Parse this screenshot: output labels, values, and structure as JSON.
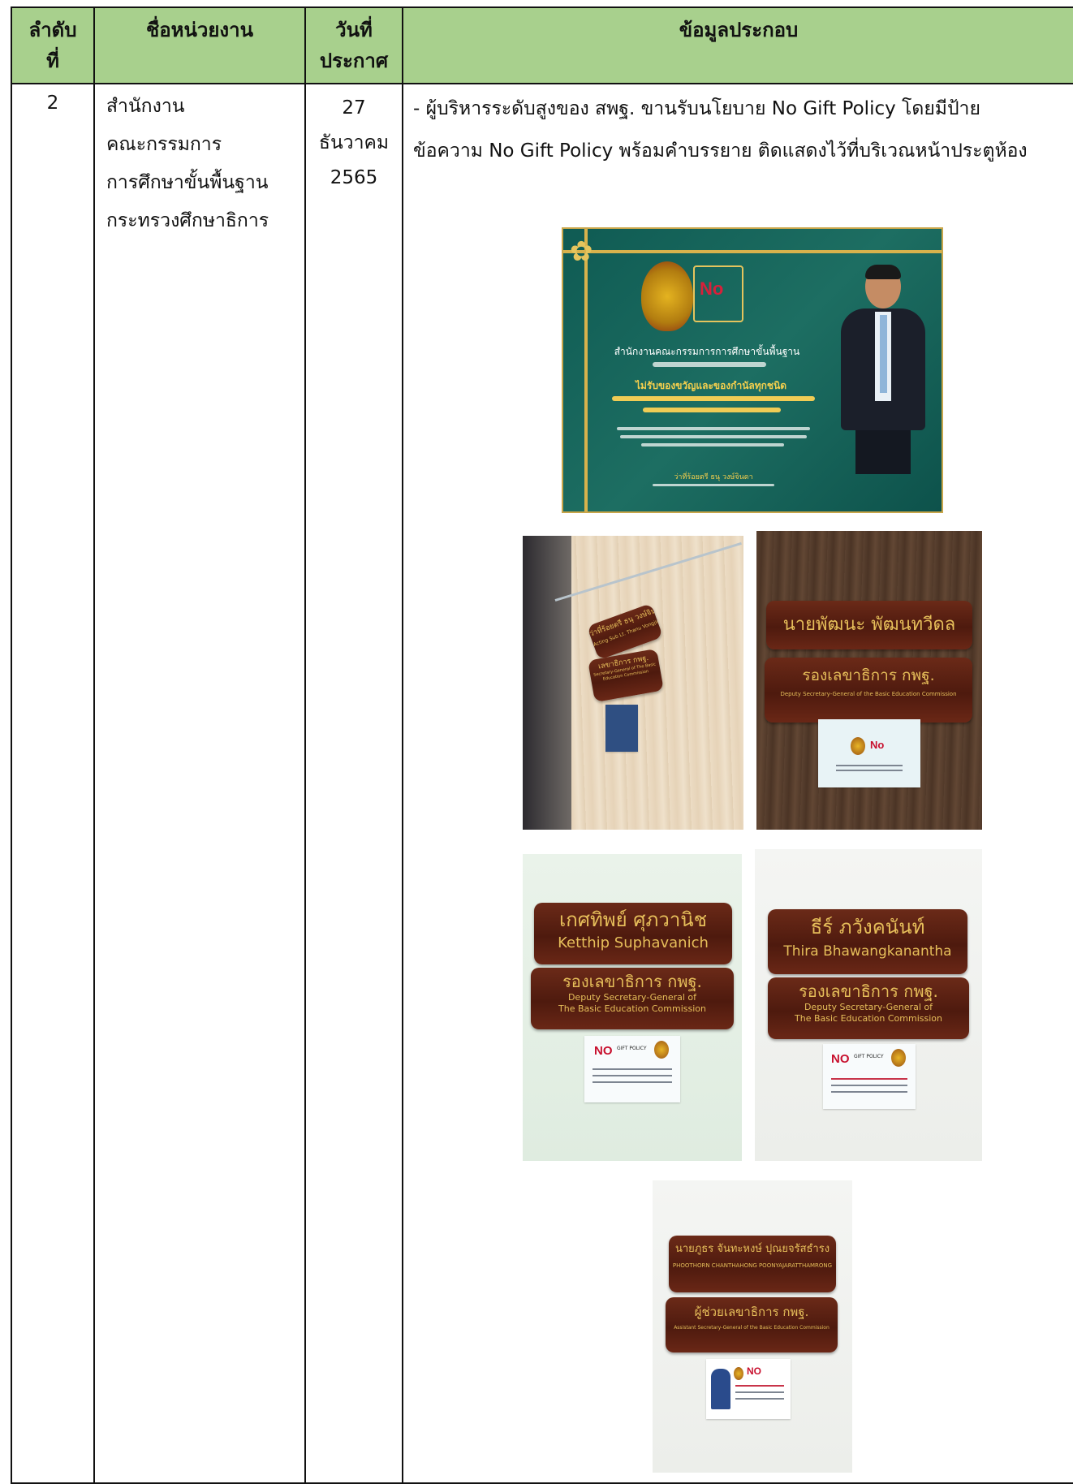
{
  "table": {
    "headers": {
      "no_line1": "ลำดับ",
      "no_line2": "ที่",
      "agency": "ชื่อหน่วยงาน",
      "date_line1": "วันที่",
      "date_line2": "ประกาศ",
      "info": "ข้อมูลประกอบ"
    },
    "row": {
      "no": "2",
      "agency_lines": [
        "สำนักงาน",
        "คณะกรรมการ",
        "การศึกษาขั้นพื้นฐาน",
        "กระทรวงศึกษาธิการ"
      ],
      "date_lines": [
        "27",
        "ธันวาคม",
        "2565"
      ],
      "info_text": "- ผู้บริหารระดับสูงของ สพฐ. ขานรับนโยบาย No Gift Policy โดยมีป้ายข้อความ No Gift Policy พร้อมคำบรรยาย ติดแสดงไว้ที่บริเวณหน้าประตูห้อง"
    }
  },
  "photos": {
    "poster": {
      "nogift": "No",
      "heading": "สำนักงานคณะกรรมการการศึกษาขั้นพื้นฐาน",
      "slogan": "ไม่รับของขวัญและของกำนัลทุกชนิด",
      "signer": "ว่าที่ร้อยตรี ธนุ วงษ์จินดา"
    },
    "door1": {
      "plate_name": "ว่าที่ร้อยตรี ธนุ วงษ์จินดา",
      "plate_name_en": "Acting Sub Lt. Thanu Vongjinda",
      "plate_title": "เลขาธิการ กพฐ.",
      "plate_title_en": "Secretary-General of The Basic Education Commission"
    },
    "door2": {
      "plate_name": "นายพัฒนะ พัฒนทวีดล",
      "plate_title": "รองเลขาธิการ กพฐ.",
      "plate_title_en": "Deputy Secretary-General of the Basic Education Commission",
      "paper_no": "No"
    },
    "door3": {
      "plate_name": "เกศทิพย์ ศุภวานิช",
      "plate_name_en": "Ketthip Suphavanich",
      "plate_title": "รองเลขาธิการ กพฐ.",
      "plate_title_en1": "Deputy Secretary-General of",
      "plate_title_en2": "The Basic Education Commission",
      "paper_no": "NO",
      "paper_gift": "GIFT POLICY"
    },
    "door4": {
      "plate_name": "ธีร์ ภวังคนันท์",
      "plate_name_en": "Thira Bhawangkanantha",
      "plate_title": "รองเลขาธิการ กพฐ.",
      "plate_title_en1": "Deputy Secretary-General of",
      "plate_title_en2": "The Basic Education Commission",
      "paper_no": "NO",
      "paper_gift": "GIFT POLICY"
    },
    "door5": {
      "plate_name": "นายภูธร จันทะหงษ์ ปุณยจรัสธำรง",
      "plate_name_en": "PHOOTHORN CHANTHAHONG POONYAJARATTHAMRONG",
      "plate_title": "ผู้ช่วยเลขาธิการ กพฐ.",
      "plate_title_en": "Assistant Secretary-General of the Basic Education Commission",
      "paper_no": "NO"
    }
  },
  "colors": {
    "header_bg": "#a8d08d",
    "plate_wood": "#5a1f12",
    "plate_text": "#e6be5a",
    "poster_bg": "#0f5b53"
  }
}
